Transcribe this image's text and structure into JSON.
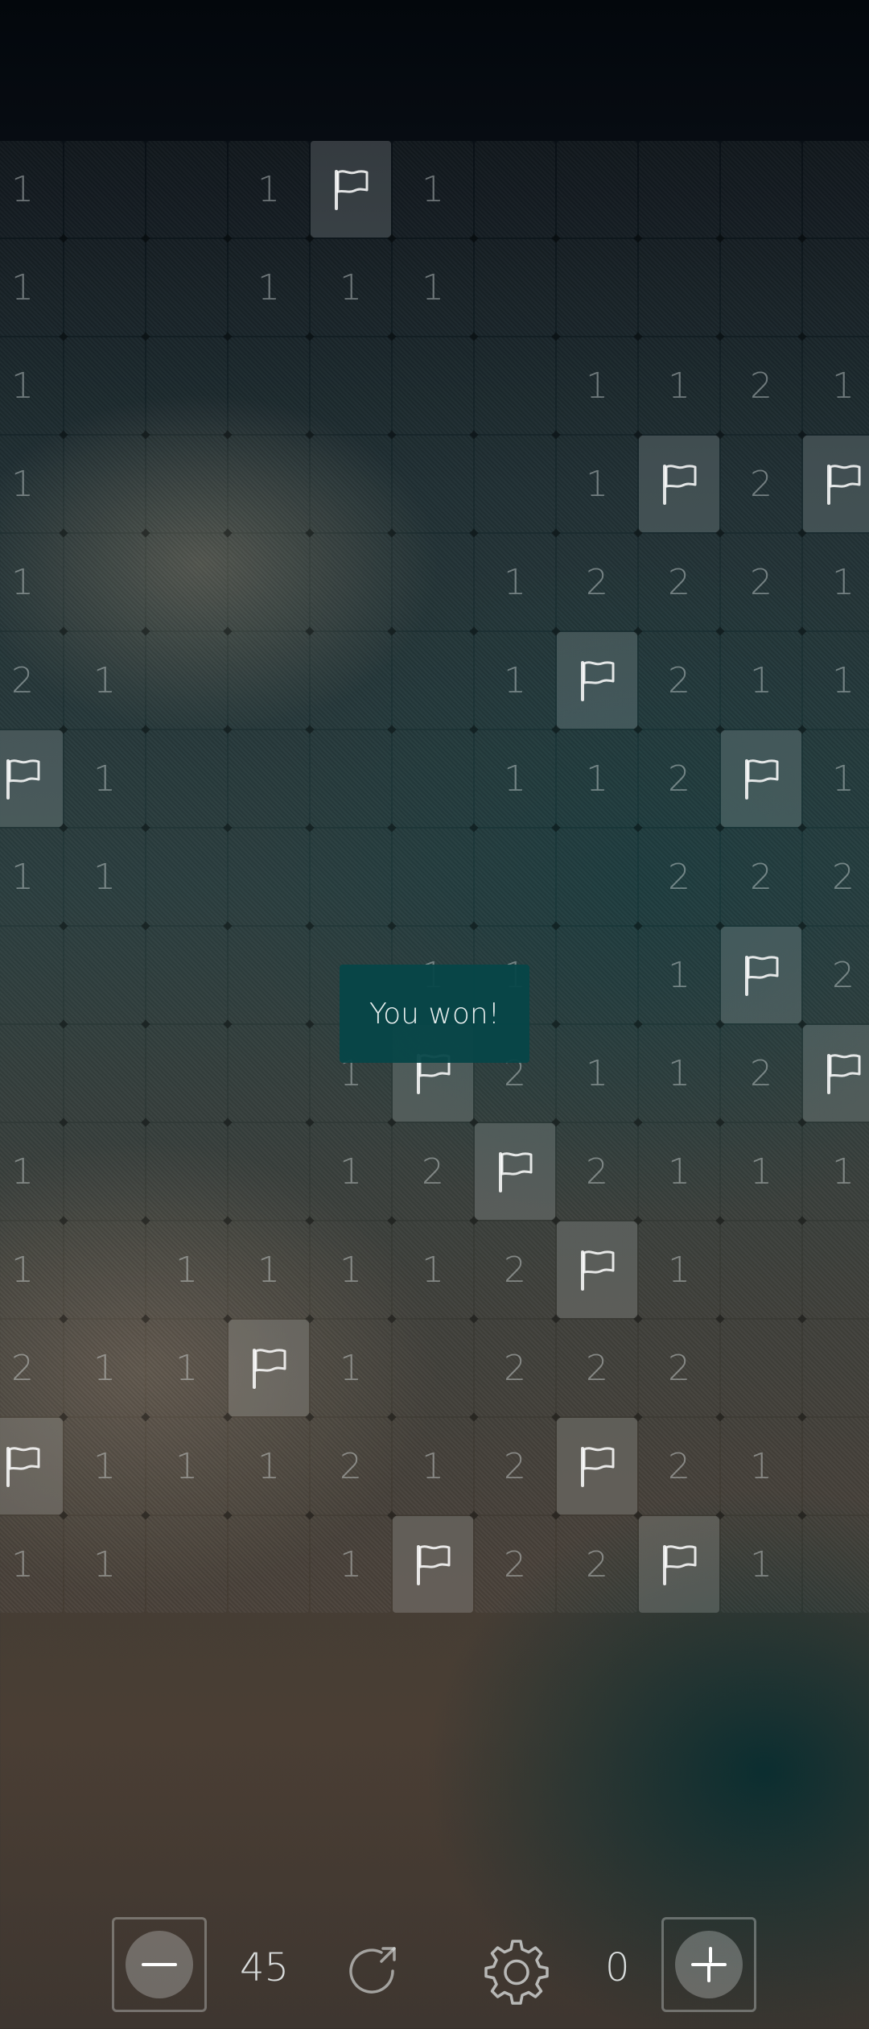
{
  "board": {
    "rows": [
      [
        "1",
        "",
        "",
        "1",
        "F",
        "1",
        "",
        "",
        "",
        "",
        ""
      ],
      [
        "1",
        "",
        "",
        "1",
        "1",
        "1",
        "",
        "",
        "",
        "",
        ""
      ],
      [
        "1",
        "",
        "",
        "",
        "",
        "",
        "",
        "1",
        "1",
        "2",
        "1"
      ],
      [
        "1",
        "",
        "",
        "",
        "",
        "",
        "",
        "1",
        "F",
        "2",
        "F"
      ],
      [
        "1",
        "",
        "",
        "",
        "",
        "",
        "1",
        "2",
        "2",
        "2",
        "1"
      ],
      [
        "2",
        "1",
        "",
        "",
        "",
        "",
        "1",
        "F",
        "2",
        "1",
        "1"
      ],
      [
        "F",
        "1",
        "",
        "",
        "",
        "",
        "1",
        "1",
        "2",
        "F",
        "1"
      ],
      [
        "1",
        "1",
        "",
        "",
        "",
        "",
        "",
        "",
        "2",
        "2",
        "2"
      ],
      [
        "",
        "",
        "",
        "",
        "",
        "1",
        "1",
        "",
        "1",
        "F",
        "2"
      ],
      [
        "",
        "",
        "",
        "",
        "1",
        "F",
        "2",
        "1",
        "1",
        "2",
        "F"
      ],
      [
        "1",
        "",
        "",
        "",
        "1",
        "2",
        "F",
        "2",
        "1",
        "1",
        "1"
      ],
      [
        "1",
        "",
        "1",
        "1",
        "1",
        "1",
        "2",
        "F",
        "1",
        "",
        ""
      ],
      [
        "2",
        "1",
        "1",
        "F",
        "1",
        "",
        "2",
        "2",
        "2",
        "",
        ""
      ],
      [
        "F",
        "1",
        "1",
        "1",
        "2",
        "1",
        "2",
        "F",
        "2",
        "1",
        ""
      ],
      [
        "1",
        "1",
        "",
        "",
        "1",
        "F",
        "2",
        "2",
        "F",
        "1",
        ""
      ]
    ],
    "flag_icon": "flag-icon"
  },
  "toast": {
    "message": "You won!"
  },
  "toolbar": {
    "decrease_icon": "minus-icon",
    "mine_count": "45",
    "restart_icon": "restart-icon",
    "settings_icon": "gear-icon",
    "time": "0",
    "increase_icon": "plus-icon"
  },
  "colors": {
    "toast_bg": "#064648",
    "flag_cell": "#8e9595"
  }
}
